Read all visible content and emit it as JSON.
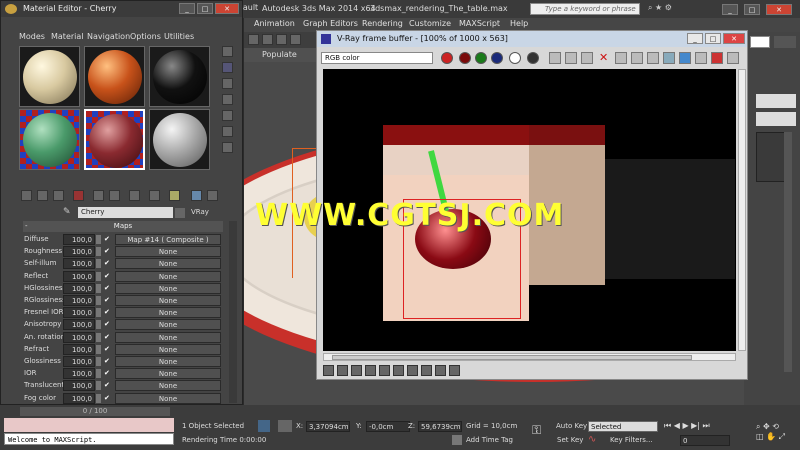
{
  "main_window": {
    "workspace_label": "Workspace: Default",
    "app_title": "Autodesk 3ds Max  2014 x64",
    "file_title": "3dsmax_rendering_The_table.max",
    "search_placeholder": "Type a keyword or phrase"
  },
  "main_menu": [
    "Animation",
    "Graph Editors",
    "Rendering",
    "Customize",
    "MAXScript",
    "Help"
  ],
  "populate_label": "Populate",
  "material_editor": {
    "title": "Material Editor - Cherry",
    "menu": [
      "Modes",
      "Material",
      "Navigation",
      "Options",
      "Utilities"
    ],
    "material_name": "Cherry",
    "renderer_label": "VRay",
    "maps_header": "Maps",
    "maps": [
      {
        "label": "Diffuse",
        "value": "100,0",
        "checked": "✔",
        "map": "Map #14  ( Composite )"
      },
      {
        "label": "Roughness",
        "value": "100,0",
        "checked": "✔",
        "map": "None"
      },
      {
        "label": "Self-illum",
        "value": "100,0",
        "checked": "✔",
        "map": "None"
      },
      {
        "label": "Reflect",
        "value": "100,0",
        "checked": "✔",
        "map": "None"
      },
      {
        "label": "HGlossiness",
        "value": "100,0",
        "checked": "✔",
        "map": "None"
      },
      {
        "label": "RGlossiness",
        "value": "100,0",
        "checked": "✔",
        "map": "None"
      },
      {
        "label": "Fresnel IOR",
        "value": "100,0",
        "checked": "✔",
        "map": "None"
      },
      {
        "label": "Anisotropy",
        "value": "100,0",
        "checked": "✔",
        "map": "None"
      },
      {
        "label": "An. rotation",
        "value": "100,0",
        "checked": "✔",
        "map": "None"
      },
      {
        "label": "Refract",
        "value": "100,0",
        "checked": "✔",
        "map": "None"
      },
      {
        "label": "Glossiness",
        "value": "100,0",
        "checked": "✔",
        "map": "None"
      },
      {
        "label": "IOR",
        "value": "100,0",
        "checked": "✔",
        "map": "None"
      },
      {
        "label": "Translucent",
        "value": "100,0",
        "checked": "✔",
        "map": "None"
      },
      {
        "label": "Fog color",
        "value": "100,0",
        "checked": "✔",
        "map": "None"
      }
    ]
  },
  "vfb": {
    "title": "V-Ray frame buffer - [100% of 1000 x 563]",
    "channel": "RGB color"
  },
  "watermark": "WWW.CGTSJ.COM",
  "status": {
    "timeline": "0 / 100",
    "maxscript": "Welcome to MAXScript.",
    "selection": "1 Object Selected",
    "render_time": "Rendering Time  0:00:00",
    "x_label": "X:",
    "x_value": "3,37094cm",
    "y_label": "Y:",
    "y_value": "-0,0cm",
    "z_label": "Z:",
    "z_value": "59,6739cm",
    "grid": "Grid = 10,0cm",
    "add_time_tag": "Add Time Tag",
    "auto_key": "Auto Key",
    "set_key": "Set Key",
    "selected_option": "Selected",
    "key_filters": "Key Filters...",
    "frame": "0"
  },
  "colors": {
    "ui_dark": "#444444",
    "vfb_bg": "#d8d8d8",
    "watermark": "#ffff33",
    "cherry": "#8a0a14"
  }
}
